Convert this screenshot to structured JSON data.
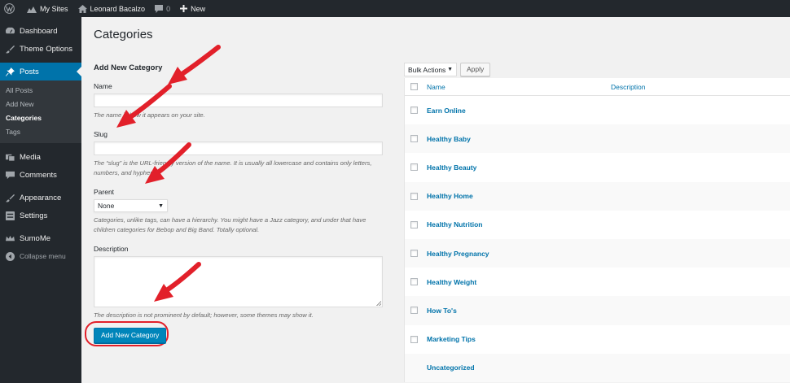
{
  "adminbar": {
    "my_sites": "My Sites",
    "site_name": "Leonard Bacalzo",
    "comments_count": "0",
    "new_label": "New"
  },
  "menu": {
    "dashboard": "Dashboard",
    "theme_options": "Theme Options",
    "posts": "Posts",
    "posts_sub": [
      "All Posts",
      "Add New",
      "Categories",
      "Tags"
    ],
    "media": "Media",
    "comments": "Comments",
    "appearance": "Appearance",
    "settings": "Settings",
    "sumome": "SumoMe",
    "collapse": "Collapse menu"
  },
  "page": {
    "title": "Categories"
  },
  "form": {
    "heading": "Add New Category",
    "name_label": "Name",
    "name_help": "The name is how it appears on your site.",
    "slug_label": "Slug",
    "slug_help": "The “slug” is the URL-friendly version of the name. It is usually all lowercase and contains only letters, numbers, and hyphens.",
    "parent_label": "Parent",
    "parent_value": "None",
    "parent_help": "Categories, unlike tags, can have a hierarchy. You might have a Jazz category, and under that have children categories for Bebop and Big Band. Totally optional.",
    "description_label": "Description",
    "description_help": "The description is not prominent by default; however, some themes may show it.",
    "submit": "Add New Category"
  },
  "table": {
    "bulk_actions": "Bulk Actions",
    "apply": "Apply",
    "col_name": "Name",
    "col_description": "Description",
    "rows": [
      "Earn Online",
      "Healthy Baby",
      "Healthy Beauty",
      "Healthy Home",
      "Healthy Nutrition",
      "Healthy Pregnancy",
      "Healthy Weight",
      "How To's",
      "Marketing Tips",
      "Uncategorized"
    ]
  },
  "colors": {
    "admin_dark": "#23282d",
    "admin_blue": "#0073aa",
    "annotation_red": "#e2202a"
  }
}
